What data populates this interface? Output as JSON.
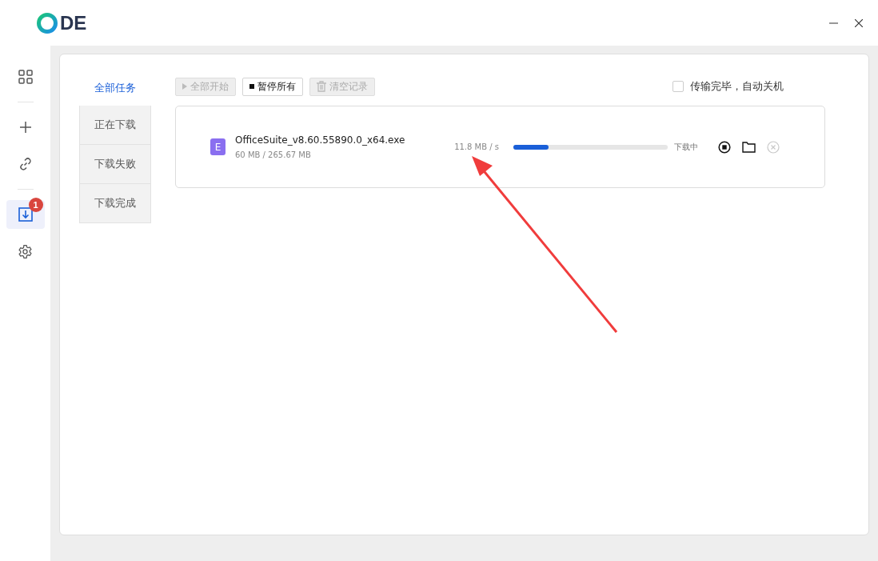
{
  "logo": {
    "text": "DE"
  },
  "nav": [
    {
      "kind": "grid",
      "selected": false
    },
    {
      "kind": "divider"
    },
    {
      "kind": "plus",
      "selected": false
    },
    {
      "kind": "link",
      "selected": false
    },
    {
      "kind": "divider"
    },
    {
      "kind": "download",
      "selected": true,
      "badge": "1"
    },
    {
      "kind": "gear",
      "selected": false
    }
  ],
  "tabs": [
    {
      "label": "全部任务",
      "selected": true
    },
    {
      "label": "正在下载",
      "selected": false
    },
    {
      "label": "下载失败",
      "selected": false
    },
    {
      "label": "下载完成",
      "selected": false
    }
  ],
  "toolbar": [
    {
      "kind": "play",
      "label": "全部开始",
      "disabled": true
    },
    {
      "kind": "stop",
      "label": "暂停所有",
      "disabled": false
    },
    {
      "kind": "trash",
      "label": "清空记录",
      "disabled": true
    }
  ],
  "shutdown_option": {
    "label": "传输完毕，自动关机",
    "checked": false
  },
  "tasks": [
    {
      "icon_letter": "E",
      "name": "OfficeSuite_v8.60.55890.0_x64.exe",
      "size": "60 MB / 265.67 MB",
      "speed": "11.8 MB / s",
      "level": 0.23,
      "status": "下载中"
    }
  ],
  "annotation": {
    "kind": "arrow"
  }
}
